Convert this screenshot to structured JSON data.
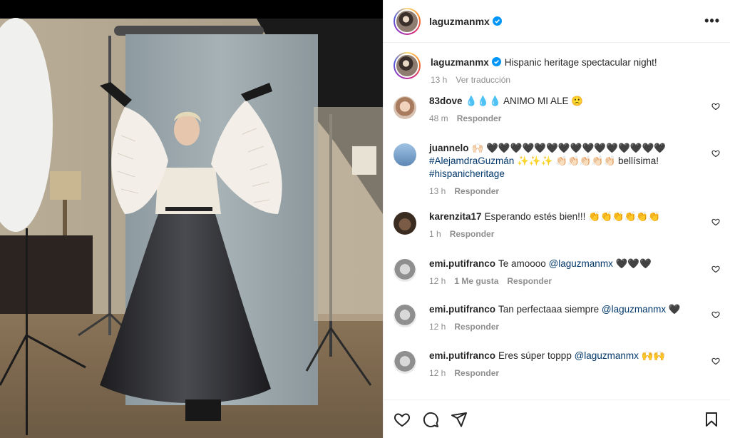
{
  "post": {
    "username": "laguzmanmx",
    "more_label": "•••"
  },
  "caption": {
    "username": "laguzmanmx",
    "text": "Hispanic heritage spectacular night!",
    "time": "13 h",
    "translate": "Ver traducción"
  },
  "comments": [
    {
      "username": "83dove",
      "text": "💧💧💧 ANIMO MI ALE 🙁",
      "time": "48 m",
      "reply": "Responder"
    },
    {
      "username": "juannelo",
      "text_pre": "🙌🏻 🖤🖤🖤🖤🖤🖤🖤🖤🖤🖤🖤🖤🖤🖤🖤",
      "mention": "#AlejamdraGuzmán",
      "text_mid": " ✨✨✨ 👏🏻👏🏻👏🏻👏🏻👏🏻 bellísima!",
      "hashtag": "#hispanicheritage",
      "time": "13 h",
      "reply": "Responder"
    },
    {
      "username": "karenzita17",
      "text": "Esperando estés bien!!! 👏👏👏👏👏👏",
      "time": "1 h",
      "reply": "Responder"
    },
    {
      "username": "emi.putifranco",
      "text": "Te amoooo",
      "mention": "@laguzmanmx",
      "text_post": " 🖤🖤🖤",
      "time": "12 h",
      "likes": "1 Me gusta",
      "reply": "Responder"
    },
    {
      "username": "emi.putifranco",
      "text": "Tan perfectaaa siempre",
      "mention": "@laguzmanmx",
      "text_post": " 🖤",
      "time": "12 h",
      "reply": "Responder"
    },
    {
      "username": "emi.putifranco",
      "text": "Eres súper toppp",
      "mention": "@laguzmanmx",
      "text_post": " 🙌🙌",
      "time": "12 h",
      "reply": "Responder"
    }
  ],
  "colors": {
    "link": "#00376b",
    "muted": "#8e8e8e",
    "verified": "#0095f6"
  },
  "icons": [
    "verified-icon",
    "more-icon",
    "heart-icon",
    "comment-icon",
    "share-icon",
    "bookmark-icon"
  ]
}
